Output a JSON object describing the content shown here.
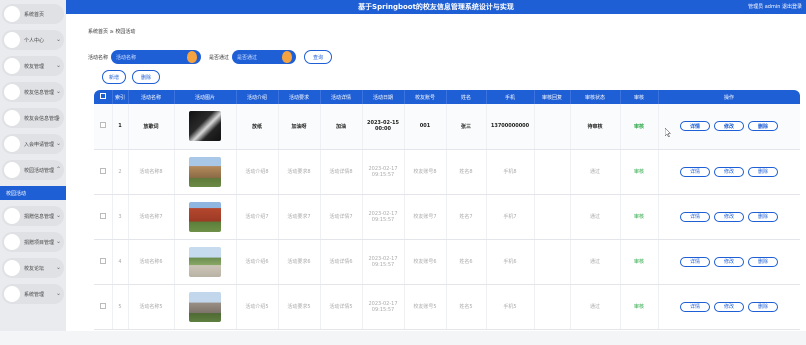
{
  "app": {
    "title": "基于Springboot的校友信息管理系统设计与实现",
    "user": "管理员 admin  退出登录"
  },
  "sidebar": {
    "items": [
      {
        "label": "系统首页",
        "chev": ""
      },
      {
        "label": "个人中心",
        "chev": "⌄"
      },
      {
        "label": "校友管理",
        "chev": "⌄"
      },
      {
        "label": "校友信息管理",
        "chev": "⌄"
      },
      {
        "label": "校友会信息管理",
        "chev": "⌄"
      },
      {
        "label": "入会申请管理",
        "chev": "⌄"
      },
      {
        "label": "校园活动管理",
        "chev": "⌃"
      }
    ],
    "active_sub": "校园活动",
    "items2": [
      {
        "label": "捐赠信息管理",
        "chev": "⌄"
      },
      {
        "label": "捐赠项目管理",
        "chev": "⌄"
      },
      {
        "label": "校友论坛",
        "chev": "⌄"
      },
      {
        "label": "系统管理",
        "chev": "⌄"
      }
    ]
  },
  "breadcrumb": "系统首页  ≥  校园活动",
  "search": {
    "name_label": "活动名称",
    "name_placeholder": "活动名称",
    "review_label": "是否通过",
    "review_placeholder": "是否通过",
    "query_label": "查询"
  },
  "toolbar": {
    "add_label": "新增",
    "delete_label": "删除"
  },
  "table": {
    "headers": [
      "",
      "索引",
      "活动名称",
      "活动图片",
      "活动介绍",
      "活动要求",
      "活动详情",
      "活动日期",
      "校友账号",
      "姓名",
      "手机",
      "审核回复",
      "审核状态",
      "审核",
      "操作"
    ],
    "rows": [
      {
        "idx": "1",
        "name": "放歌词",
        "intro": "放纸",
        "req": "加油呀",
        "detail": "加油",
        "date": "2023-02-15 00:00",
        "account": "001",
        "person": "张三",
        "phone": "13700000000",
        "reply": "",
        "state": "待审核",
        "review": "审核"
      },
      {
        "idx": "2",
        "name": "活动名称8",
        "intro": "活动介绍8",
        "req": "活动要求8",
        "detail": "活动详情8",
        "date": "2023-02-17 09:15:57",
        "account": "校友账号8",
        "person": "姓名8",
        "phone": "手机8",
        "reply": "",
        "state": "通过",
        "review": "审核"
      },
      {
        "idx": "3",
        "name": "活动名称7",
        "intro": "活动介绍7",
        "req": "活动要求7",
        "detail": "活动详情7",
        "date": "2023-02-17 09:15:57",
        "account": "校友账号7",
        "person": "姓名7",
        "phone": "手机7",
        "reply": "",
        "state": "通过",
        "review": "审核"
      },
      {
        "idx": "4",
        "name": "活动名称6",
        "intro": "活动介绍6",
        "req": "活动要求6",
        "detail": "活动详情6",
        "date": "2023-02-17 09:15:57",
        "account": "校友账号6",
        "person": "姓名6",
        "phone": "手机6",
        "reply": "",
        "state": "通过",
        "review": "审核"
      },
      {
        "idx": "5",
        "name": "活动名称5",
        "intro": "活动介绍5",
        "req": "活动要求5",
        "detail": "活动详情5",
        "date": "2023-02-17 09:15:57",
        "account": "校友账号5",
        "person": "姓名5",
        "phone": "手机5",
        "reply": "",
        "state": "通过",
        "review": "审核"
      }
    ],
    "op_labels": {
      "detail": "详情",
      "edit": "修改",
      "delete": "删除"
    }
  },
  "colors": {
    "primary": "#1f5fd6",
    "success": "#29a745",
    "accent": "#f4a340"
  },
  "icons": {
    "nav": "circle-icon",
    "chevron": "chevron-down-icon",
    "cursor": "mouse-cursor-icon"
  }
}
